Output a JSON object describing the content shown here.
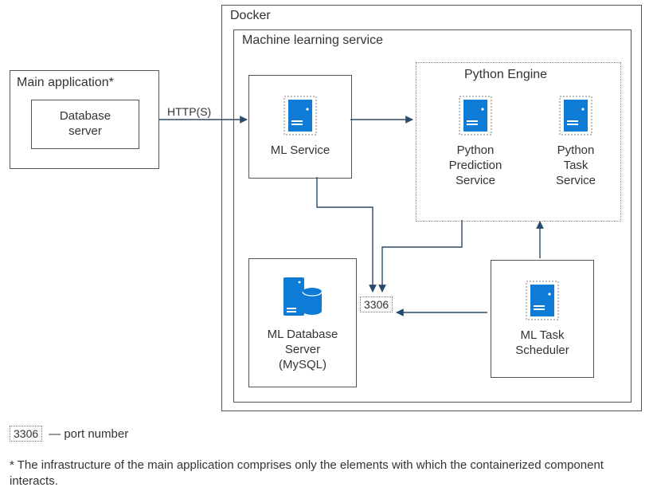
{
  "main_app": {
    "title": "Main application*",
    "db_server_label": "Database\nserver"
  },
  "docker": {
    "title": "Docker",
    "ml_service_container_title": "Machine learning service",
    "ml_service_label": "ML Service",
    "python_engine_title": "Python Engine",
    "python_prediction_label": "Python\nPrediction\nService",
    "python_task_label": "Python\nTask\nService",
    "ml_db_label": "ML Database\nServer\n(MySQL)",
    "ml_task_scheduler_label": "ML Task\nScheduler"
  },
  "edges": {
    "http_label": "HTTP(S)"
  },
  "ports": {
    "ml_db_port": "3306"
  },
  "legend": {
    "port_sample": "3306",
    "port_text": "— port number"
  },
  "footnote": "* The infrastructure of the main application comprises only the elements with which the containerized component interacts.",
  "colors": {
    "icon_blue": "#0E7CD6"
  }
}
